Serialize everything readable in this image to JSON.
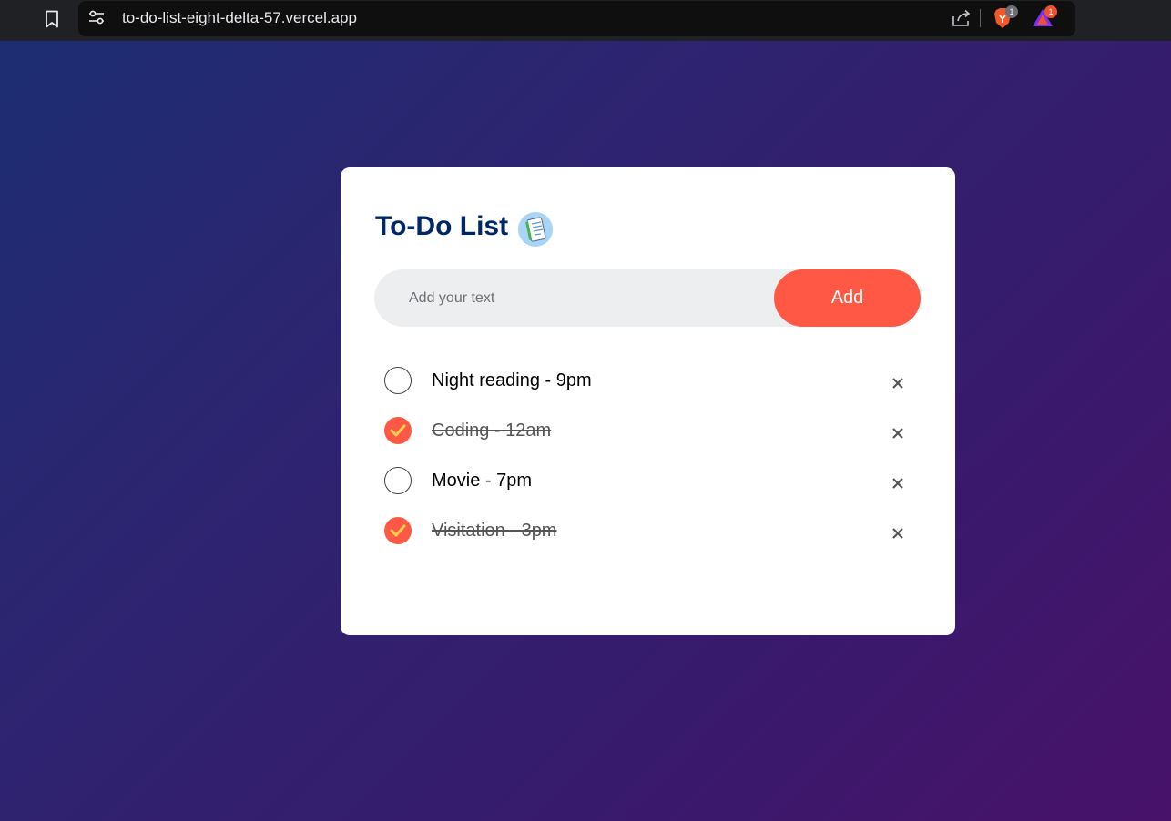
{
  "browser": {
    "url": "to-do-list-eight-delta-57.vercel.app",
    "brave_badge": "1",
    "rewards_badge": "1"
  },
  "app": {
    "title": "To-Do List",
    "input": {
      "placeholder": "Add your text",
      "value": ""
    },
    "add_label": "Add",
    "tasks": [
      {
        "text": "Night reading - 9pm",
        "checked": false
      },
      {
        "text": "Coding - 12am",
        "checked": true
      },
      {
        "text": "Movie - 7pm",
        "checked": false
      },
      {
        "text": "Visitation - 3pm",
        "checked": true
      }
    ]
  },
  "colors": {
    "accent": "#ff5945",
    "title": "#002765",
    "check": "#ffd34d"
  },
  "icons": {
    "bookmark": "bookmark-icon",
    "site_info": "tune-icon",
    "share": "share-icon",
    "brave": "brave-shield-icon",
    "rewards": "brave-rewards-icon",
    "title_icon": "notepad-icon",
    "delete": "close-icon",
    "check": "checkmark-icon"
  }
}
